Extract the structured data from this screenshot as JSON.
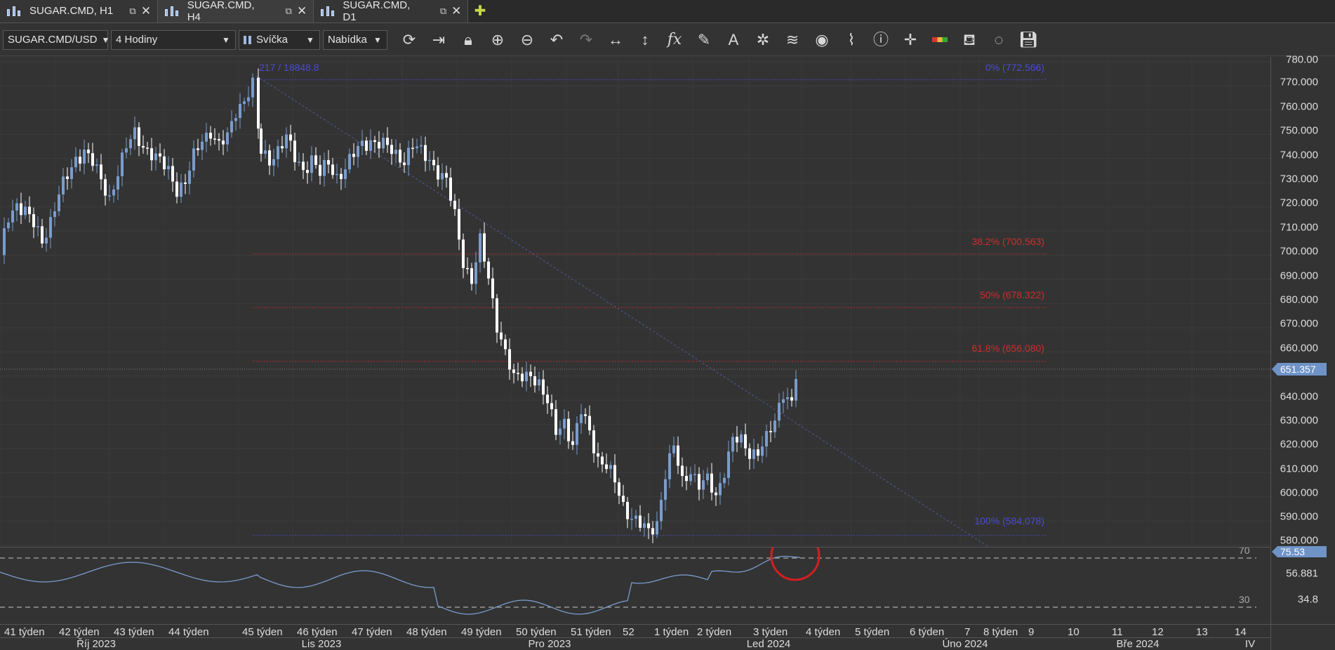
{
  "tabs": [
    {
      "label": "SUGAR.CMD, H1",
      "active": false
    },
    {
      "label": "SUGAR.CMD, H4",
      "active": true
    },
    {
      "label": "SUGAR.CMD, D1",
      "active": false
    }
  ],
  "tab_icons": {
    "chart": "candlestick-chart-icon",
    "popout": "popout-icon",
    "close": "close-icon",
    "add": "add-chart-icon"
  },
  "toolbar": {
    "symbol": "SUGAR.CMD/USD",
    "timeframe": "4 Hodiny",
    "chart_type": "Svíčka",
    "price_type": "Nabídka",
    "tools": [
      "refresh-icon",
      "autoscroll-icon",
      "lock-icon",
      "zoom-in-icon",
      "zoom-out-icon",
      "undo-icon",
      "redo-icon",
      "horizontal-arrows-icon",
      "vertical-arrows-icon",
      "function-icon",
      "pencil-icon",
      "text-icon",
      "crosshair-star-icon",
      "layers-icon",
      "eye-icon",
      "pattern-icon",
      "info-icon",
      "crosshair-icon",
      "color-bar-icon",
      "paint-bucket-icon",
      "reset-icon",
      "save-icon"
    ]
  },
  "chart": {
    "price_ticks": [
      "780.00",
      "770.000",
      "760.000",
      "750.000",
      "740.000",
      "730.000",
      "720.000",
      "710.000",
      "700.000",
      "690.000",
      "680.000",
      "670.000",
      "660.000",
      "650.000",
      "640.000",
      "630.000",
      "620.000",
      "610.000",
      "600.000",
      "590.000",
      "580.000"
    ],
    "current_price": "651.357",
    "fib_top_left": "217 / 18848.8",
    "fib_levels": [
      {
        "label": "0% (772.566)",
        "price": 772.566,
        "color": "#4a4ad8"
      },
      {
        "label": "38.2% (700.563)",
        "price": 700.563,
        "color": "#d12b2b"
      },
      {
        "label": "50% (678.322)",
        "price": 678.322,
        "color": "#d12b2b"
      },
      {
        "label": "61.8% (656.080)",
        "price": 656.08,
        "color": "#d12b2b"
      },
      {
        "label": "100% (584.078)",
        "price": 584.078,
        "color": "#4a4ad8"
      }
    ],
    "up_color": "#7a9ccc",
    "down_color": "#ffffff"
  },
  "indicator": {
    "value": "75.53",
    "ticks": [
      "56.881",
      "34.8"
    ],
    "levels": [
      "70",
      "30"
    ],
    "line_color": "#7a9ccc",
    "highlight_color": "#d41f1f"
  },
  "time_axis": {
    "weeks": [
      "41 týden",
      "42 týden",
      "43 týden",
      "44 týden",
      "45 týden",
      "46 týden",
      "47 týden",
      "48 týden",
      "49 týden",
      "50 týden",
      "51 týden",
      "52",
      "1 týden",
      "2 týden",
      "3 týden",
      "4 týden",
      "5 týden",
      "6 týden",
      "7",
      "8 týden",
      "9",
      "10",
      "11",
      "12",
      "13",
      "14"
    ],
    "months": [
      "Říj 2023",
      "Lis 2023",
      "Pro 2023",
      "Led 2024",
      "Úno 2024",
      "Bře 2024",
      "IV"
    ]
  }
}
